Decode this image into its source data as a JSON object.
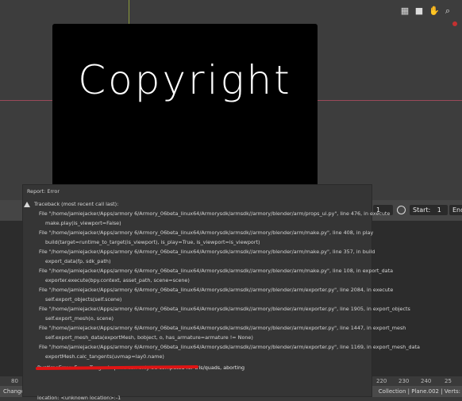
{
  "viewport": {
    "watermark": "Copyright",
    "icons": [
      "grid-icon",
      "camera-icon",
      "hand-icon",
      "zoom-icon"
    ]
  },
  "timeline": {
    "frame_current": "1",
    "start_label": "Start:",
    "start_value": "1",
    "end_label": "End:",
    "ruler_ticks": [
      "80",
      "220",
      "230",
      "240",
      "25"
    ]
  },
  "status": {
    "left": "Change Frame",
    "right": "Collection | Plane.002 | Verts:"
  },
  "report": {
    "title": "Report: Error",
    "lines": [
      "Traceback (most recent call last):",
      "File \"/home/jamiejacker/Apps/armory 6/Armory_06beta_linux64/Armorysdk/armsdk//armory/blender/arm/props_ui.py\", line 476, in execute",
      "make.play(is_viewport=False)",
      "File \"/home/jamiejacker/Apps/armory 6/Armory_06beta_linux64/Armorysdk/armsdk//armory/blender/arm/make.py\", line 408, in play",
      "build(target=runtime_to_target(is_viewport), is_play=True, is_viewport=is_viewport)",
      "File \"/home/jamiejacker/Apps/armory 6/Armory_06beta_linux64/Armorysdk/armsdk//armory/blender/arm/make.py\", line 357, in build",
      "export_data(fp, sdk_path)",
      "File \"/home/jamiejacker/Apps/armory 6/Armory_06beta_linux64/Armorysdk/armsdk//armory/blender/arm/make.py\", line 108, in export_data",
      "exporter.execute(bpy.context, asset_path, scene=scene)",
      "File \"/home/jamiejacker/Apps/armory 6/Armory_06beta_linux64/Armorysdk/armsdk//armory/blender/arm/exporter.py\", line 2084, in execute",
      "self.export_objects(self.scene)",
      "File \"/home/jamiejacker/Apps/armory 6/Armory_06beta_linux64/Armorysdk/armsdk//armory/blender/arm/exporter.py\", line 1905, in export_objects",
      "self.export_mesh(o, scene)",
      "File \"/home/jamiejacker/Apps/armory 6/Armory_06beta_linux64/Armorysdk/armsdk//armory/blender/arm/exporter.py\", line 1447, in export_mesh",
      "self.export_mesh_data(exportMesh, bobject, o, has_armature=armature != None)",
      "File \"/home/jamiejacker/Apps/armory 6/Armory_06beta_linux64/Armorysdk/armsdk//armory/blender/arm/exporter.py\", line 1169, in export_mesh_data",
      "exportMesh.calc_tangents(uvmap=lay0.name)",
      "RuntimeError: Error: Tangent space can only be computed for tris/quads, aborting",
      "location: <unknown location>:-1"
    ]
  },
  "colors": {
    "accent_red": "#e01414",
    "viewport_bg": "#3d3d3d"
  }
}
